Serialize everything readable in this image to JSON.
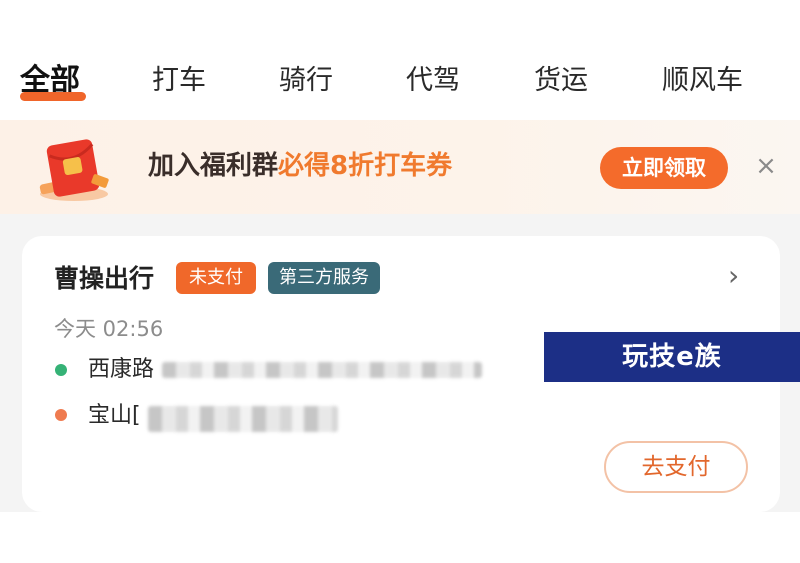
{
  "tabs": [
    {
      "label": "全部",
      "active": true
    },
    {
      "label": "打车",
      "active": false
    },
    {
      "label": "骑行",
      "active": false
    },
    {
      "label": "代驾",
      "active": false
    },
    {
      "label": "货运",
      "active": false
    },
    {
      "label": "顺风车",
      "active": false
    }
  ],
  "promo": {
    "text_prefix": "加入福利群",
    "text_highlight": "必得8折打车券",
    "button_label": "立即领取",
    "close_label": "×",
    "icon": "red-envelope-icon"
  },
  "order": {
    "title": "曹操出行",
    "badge_status": "未支付",
    "badge_service": "第三方服务",
    "time": "今天 02:56",
    "start_address": "西康路",
    "end_address": "宝山[",
    "pay_button": "去支付",
    "chevron": "›"
  },
  "watermark": "玩技e族",
  "colors": {
    "accent": "#f46b2b",
    "start_dot": "#35b276",
    "end_dot": "#ef7b50",
    "service_badge": "#3a6a78"
  }
}
